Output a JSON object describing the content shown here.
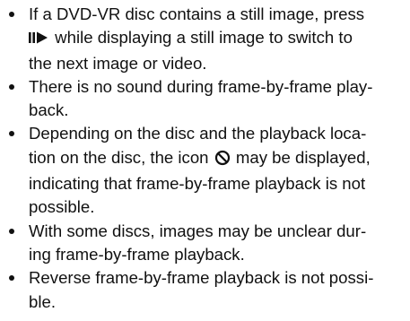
{
  "notes": [
    {
      "lines": [
        "If a DVD-VR disc contains a still image, press",
        "while displaying a still image to switch to",
        "the next image or video."
      ]
    },
    {
      "lines": [
        "There is no sound during frame-by-frame play-",
        "back."
      ]
    },
    {
      "lines": [
        "Depending on the disc and the playback loca-",
        "tion on the disc, the icon",
        "may be displayed,",
        "indicating that frame-by-frame playback is not",
        "possible."
      ]
    },
    {
      "lines": [
        "With some discs, images may be unclear dur-",
        "ing frame-by-frame playback."
      ]
    },
    {
      "lines": [
        "Reverse frame-by-frame playback is not possi-",
        "ble."
      ]
    }
  ],
  "icons": {
    "pause_play": "pause-play-icon",
    "prohibited": "prohibited-icon"
  }
}
